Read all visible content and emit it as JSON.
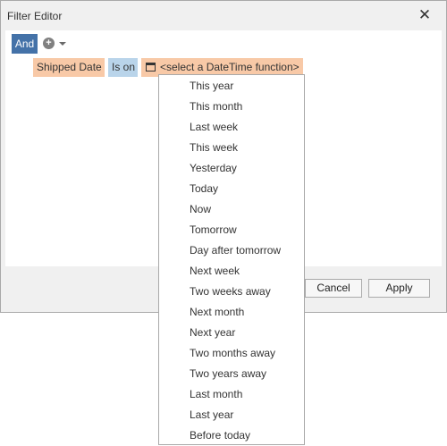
{
  "window": {
    "title": "Filter Editor",
    "close_glyph": "✕"
  },
  "toolbar": {
    "group_operator": "And",
    "add_icon": "add-circle-icon",
    "add_glyph": "+"
  },
  "condition": {
    "field": "Shipped Date",
    "operator": "Is on",
    "value_icon": "calendar-icon",
    "value": "<select a DateTime function>"
  },
  "buttons": {
    "cancel": "Cancel",
    "apply": "Apply"
  },
  "datetime_functions": [
    "This year",
    "This month",
    "Last week",
    "This week",
    "Yesterday",
    "Today",
    "Now",
    "Tomorrow",
    "Day after tomorrow",
    "Next week",
    "Two weeks away",
    "Next month",
    "Next year",
    "Two months away",
    "Two years away",
    "Last month",
    "Last year",
    "Before today"
  ],
  "colors": {
    "operator_button": "#4472a8",
    "field_chip": "#f8c9a7",
    "operator_chip": "#b9d4ea",
    "value_chip": "#f8c9a7"
  }
}
